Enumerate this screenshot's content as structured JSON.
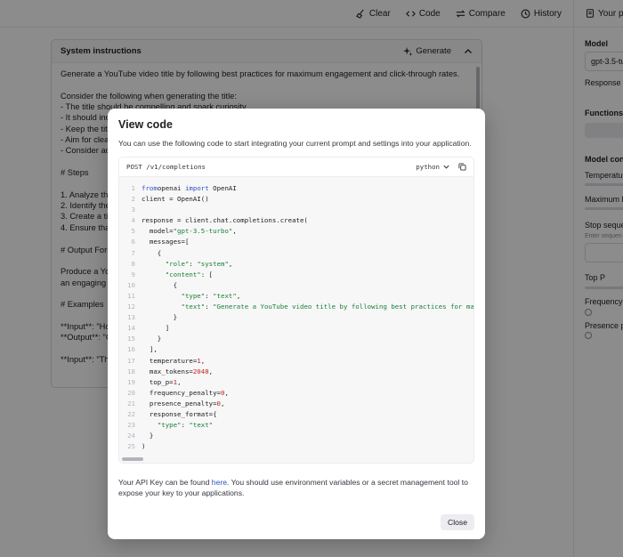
{
  "toolbar": {
    "clear": "Clear",
    "code": "Code",
    "compare": "Compare",
    "history": "History"
  },
  "system": {
    "title": "System instructions",
    "generate": "Generate",
    "lines": [
      "Generate a YouTube video title by following best practices for maximum engagement and click-through rates.",
      "",
      "Consider the following when generating the title:",
      "- The title should be compelling and spark curiosity.",
      "- It should inc",
      "- Keep the titl",
      "- Aim for clea",
      "- Consider ad",
      "",
      "# Steps",
      "",
      "1. Analyze the",
      "2. Identify the",
      "3. Create a tit",
      "4. Ensure that",
      "",
      "# Output Form",
      "",
      "Produce a You",
      "an engaging t",
      "",
      "# Examples",
      "",
      "**Input**: \"Ho",
      "**Output**: \"C",
      "",
      "**Input**: \"Th"
    ]
  },
  "sidebar": {
    "header": "Your pre",
    "model_label": "Model",
    "model_value": "gpt-3.5-tu",
    "response_label": "Response f",
    "functions_label": "Functions",
    "model_config_label": "Model confi",
    "temperature": "Temperatur",
    "max_length": "Maximum le",
    "stop_sequences": "Stop seque",
    "stop_hint": "Enter sequen",
    "top_p": "Top P",
    "frequency": "Frequency p",
    "presence": "Presence pe"
  },
  "modal": {
    "title": "View code",
    "description": "You can use the following code to start integrating your current prompt and settings into your application.",
    "endpoint": "POST /v1/completions",
    "language": "python",
    "footer_before": "Your API Key can be found ",
    "footer_link": "here",
    "footer_after": ". You should use environment variables or a secret management tool to expose your key to your applications.",
    "close": "Close"
  },
  "code": [
    {
      "n": "1",
      "t": [
        [
          "kw",
          "from"
        ],
        [
          "",
          "openai "
        ],
        [
          "kw",
          "import"
        ],
        [
          "",
          " OpenAI"
        ]
      ]
    },
    {
      "n": "2",
      "t": [
        [
          "",
          "client = OpenAI()"
        ]
      ]
    },
    {
      "n": "3",
      "t": [
        [
          "",
          ""
        ]
      ]
    },
    {
      "n": "4",
      "t": [
        [
          "",
          "response = client.chat.completions.create("
        ]
      ]
    },
    {
      "n": "5",
      "t": [
        [
          "",
          "  model="
        ],
        [
          "str",
          "\"gpt-3.5-turbo\""
        ],
        [
          "",
          ","
        ]
      ]
    },
    {
      "n": "6",
      "t": [
        [
          "",
          "  messages=["
        ]
      ]
    },
    {
      "n": "7",
      "t": [
        [
          "",
          "    {"
        ]
      ]
    },
    {
      "n": "8",
      "t": [
        [
          "",
          "      "
        ],
        [
          "str",
          "\"role\""
        ],
        [
          "",
          ": "
        ],
        [
          "str",
          "\"system\""
        ],
        [
          "",
          ","
        ]
      ]
    },
    {
      "n": "9",
      "t": [
        [
          "",
          "      "
        ],
        [
          "str",
          "\"content\""
        ],
        [
          "",
          ": ["
        ]
      ]
    },
    {
      "n": "10",
      "t": [
        [
          "",
          "        {"
        ]
      ]
    },
    {
      "n": "11",
      "t": [
        [
          "",
          "          "
        ],
        [
          "str",
          "\"type\""
        ],
        [
          "",
          ": "
        ],
        [
          "str",
          "\"text\""
        ],
        [
          "",
          ","
        ]
      ]
    },
    {
      "n": "12",
      "t": [
        [
          "",
          "          "
        ],
        [
          "str",
          "\"text\""
        ],
        [
          "",
          ": "
        ],
        [
          "str",
          "\"Generate a YouTube video title by following best practices for maximum engagement\""
        ]
      ]
    },
    {
      "n": "13",
      "t": [
        [
          "",
          "        }"
        ]
      ]
    },
    {
      "n": "14",
      "t": [
        [
          "",
          "      ]"
        ]
      ]
    },
    {
      "n": "15",
      "t": [
        [
          "",
          "    }"
        ]
      ]
    },
    {
      "n": "16",
      "t": [
        [
          "",
          "  ],"
        ]
      ]
    },
    {
      "n": "17",
      "t": [
        [
          "",
          "  temperature="
        ],
        [
          "num",
          "1"
        ],
        [
          "",
          ","
        ]
      ]
    },
    {
      "n": "18",
      "t": [
        [
          "",
          "  max_tokens="
        ],
        [
          "num",
          "2048"
        ],
        [
          "",
          ","
        ]
      ]
    },
    {
      "n": "19",
      "t": [
        [
          "",
          "  top_p="
        ],
        [
          "num",
          "1"
        ],
        [
          "",
          ","
        ]
      ]
    },
    {
      "n": "20",
      "t": [
        [
          "",
          "  frequency_penalty="
        ],
        [
          "num",
          "0"
        ],
        [
          "",
          ","
        ]
      ]
    },
    {
      "n": "21",
      "t": [
        [
          "",
          "  presence_penalty="
        ],
        [
          "num",
          "0"
        ],
        [
          "",
          ","
        ]
      ]
    },
    {
      "n": "22",
      "t": [
        [
          "",
          "  response_format={"
        ]
      ]
    },
    {
      "n": "23",
      "t": [
        [
          "",
          "    "
        ],
        [
          "str",
          "\"type\""
        ],
        [
          "",
          ": "
        ],
        [
          "str",
          "\"text\""
        ]
      ]
    },
    {
      "n": "24",
      "t": [
        [
          "",
          "  }"
        ]
      ]
    },
    {
      "n": "25",
      "t": [
        [
          "",
          ")"
        ]
      ]
    }
  ],
  "colors": {
    "keyword": "#2b52c4",
    "string": "#188038",
    "number": "#c5221f",
    "overlay": "rgba(0,0,0,0.45)"
  }
}
